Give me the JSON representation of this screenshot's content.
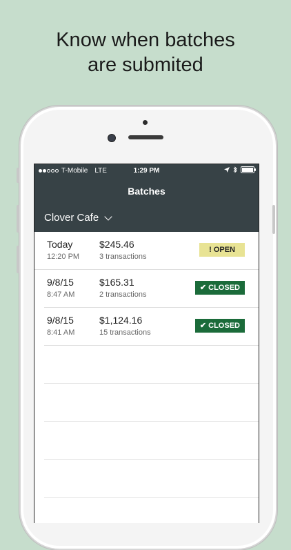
{
  "headline": {
    "line1": "Know when batches",
    "line2": "are submited"
  },
  "status_bar": {
    "carrier": "T-Mobile",
    "network": "LTE",
    "time": "1:29 PM"
  },
  "nav": {
    "title": "Batches",
    "merchant": "Clover Cafe"
  },
  "batches": [
    {
      "date": "Today",
      "time": "12:20 PM",
      "amount": "$245.46",
      "transactions": "3 transactions",
      "status": "! OPEN"
    },
    {
      "date": "9/8/15",
      "time": "8:47 AM",
      "amount": "$165.31",
      "transactions": "2 transactions",
      "status": "✔ CLOSED"
    },
    {
      "date": "9/8/15",
      "time": "8:41 AM",
      "amount": "$1,124.16",
      "transactions": "15 transactions",
      "status": "✔ CLOSED"
    }
  ],
  "colors": {
    "background": "#c6ddcc",
    "nav": "#374246",
    "open_badge": "#e8e394",
    "closed_badge": "#1b6b3a"
  }
}
